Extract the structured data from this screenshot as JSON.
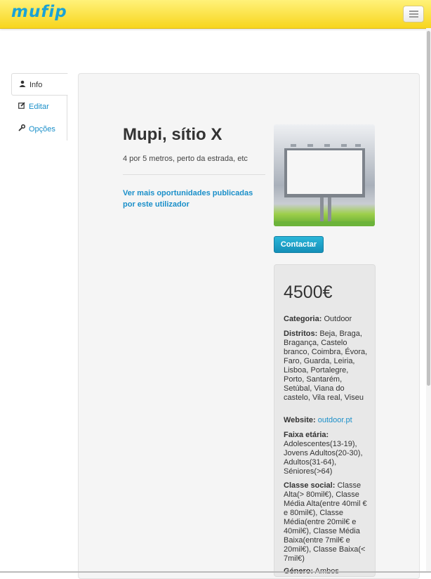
{
  "navbar": {
    "logo": "mufip",
    "menu_icon": "hamburger-icon"
  },
  "sidenav": {
    "items": [
      {
        "label": "Info",
        "icon": "user-icon",
        "active": true
      },
      {
        "label": "Editar",
        "icon": "edit-icon",
        "active": false
      },
      {
        "label": "Opções",
        "icon": "wrench-icon",
        "active": false
      }
    ]
  },
  "listing": {
    "title": "Mupi, sítio X",
    "description": "4 por 5 metros, perto da estrada, etc",
    "more_link": "Ver mais oportunidades publicadas por este utilizador",
    "contact_label": "Contactar",
    "price": "4500€",
    "fields": [
      {
        "label": "Categoria:",
        "value": "Outdoor"
      },
      {
        "label": "Distritos:",
        "value": "Beja, Braga, Bragança, Castelo branco, Coimbra, Évora, Faro, Guarda, Leiria, Lisboa, Portalegre, Porto, Santarém, Setúbal, Viana do castelo, Vila real, Viseu"
      },
      {
        "label": "Website:",
        "value": "outdoor.pt"
      },
      {
        "label": "Faixa etária:",
        "value": "Adolescentes(13-19), Jovens Adultos(20-30), Adultos(31-64), Séniores(>64)"
      },
      {
        "label": "Classe social:",
        "value": "Classe Alta(> 80mil€), Classe Média Alta(entre 40mil € e 80mil€), Classe Média(entre 20mil€ e 40mil€), Classe Média Baixa(entre 7mil€ e 20mil€), Classe Baixa(< 7mil€)"
      },
      {
        "label": "Género:",
        "value": "Ambos"
      }
    ]
  },
  "colors": {
    "navbar": "#f7d51d",
    "link": "#1a8fc9",
    "button": "#1ba3cc",
    "logo": "#1aa2d6"
  }
}
